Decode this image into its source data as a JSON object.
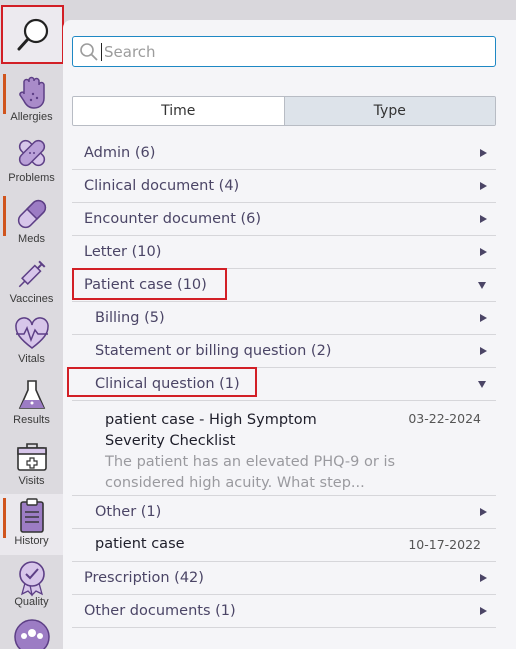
{
  "sidebar": {
    "items": [
      {
        "label": "Allergies"
      },
      {
        "label": "Problems"
      },
      {
        "label": "Meds"
      },
      {
        "label": "Vaccines"
      },
      {
        "label": "Vitals"
      },
      {
        "label": "Results"
      },
      {
        "label": "Visits"
      },
      {
        "label": "History"
      },
      {
        "label": "Quality"
      }
    ]
  },
  "search": {
    "placeholder": "Search"
  },
  "toggle": {
    "time": "Time",
    "type": "Type",
    "selected": "Type"
  },
  "categories": {
    "admin": "Admin (6)",
    "clinical_document": "Clinical document (4)",
    "encounter_document": "Encounter document (6)",
    "letter": "Letter (10)",
    "patient_case": "Patient case (10)",
    "billing": "Billing (5)",
    "statement": "Statement or billing question (2)",
    "clinical_question": "Clinical question (1)",
    "other": "Other (1)",
    "prescription": "Prescription (42)",
    "other_documents": "Other documents (1)"
  },
  "documents": {
    "doc1": {
      "title": "patient case - High Symptom Severity Checklist",
      "date": "03-22-2024",
      "desc": "The patient has an elevated PHQ-9 or is considered high acuity. What step..."
    },
    "doc2": {
      "title": "patient case",
      "date": "10-17-2022"
    }
  },
  "colors": {
    "highlight": "#d21f26",
    "accent": "#d0541d",
    "icon_purple": "#6a4c93",
    "focus": "#1e88c4"
  }
}
